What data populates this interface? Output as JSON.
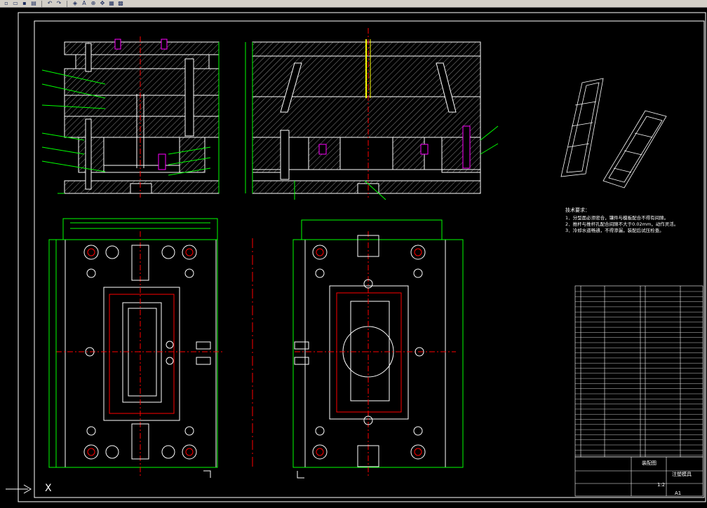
{
  "app": {
    "toolbar_icons": [
      "new-icon",
      "open-icon",
      "save-icon",
      "print-icon",
      "undo-icon",
      "redo-icon",
      "layer-icon",
      "text-icon",
      "zoom-icon",
      "pan-icon",
      "properties-icon",
      "grid-icon"
    ]
  },
  "drawing": {
    "ucs_label": "X",
    "tech_requirements": {
      "heading": "技术要求：",
      "lines": [
        "1．分型面必须密合，镶件与模板配合不得有间隙。",
        "2．推杆与推杆孔配合间隙不大于0.02mm，动作灵活。",
        "3．冷却水道畅通，不得渗漏，装配后试压检查。"
      ]
    },
    "title_block": {
      "name": "装配图",
      "scale": "1:2",
      "sheet": "A1",
      "part_name": "注塑模具"
    }
  },
  "colors": {
    "bg": "#000000",
    "outline": "#ffffff",
    "dimension": "#00ff00",
    "centerline": "#ff0000",
    "hatch": "#a0a0a0",
    "highlight": "#ff00ff",
    "accent_yellow": "#ffff00"
  }
}
